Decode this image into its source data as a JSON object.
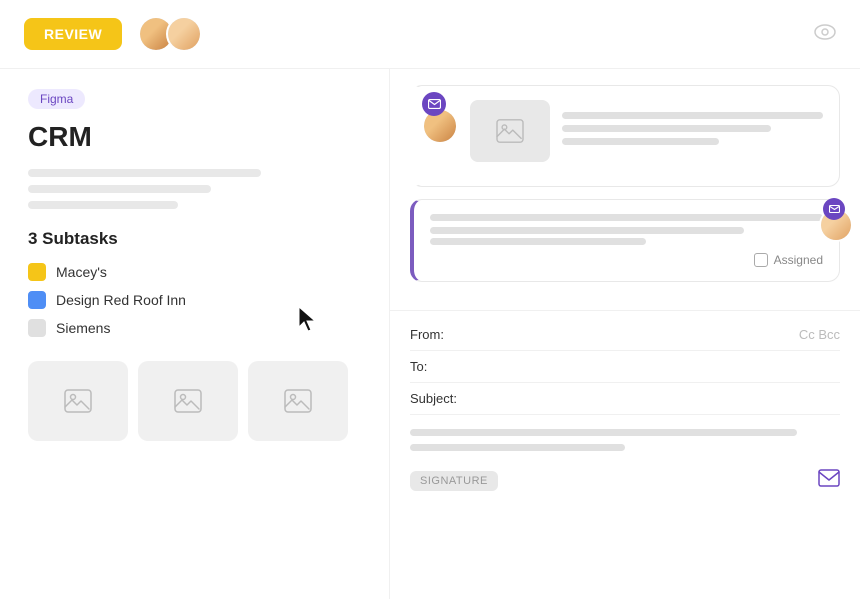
{
  "header": {
    "review_btn": "REVIEW",
    "eye_icon": "eye"
  },
  "left": {
    "badge": "Figma",
    "title": "CRM",
    "subtasks_heading": "3 Subtasks",
    "subtasks": [
      {
        "label": "Macey's",
        "color": "yellow"
      },
      {
        "label": "Design Red Roof Inn",
        "color": "blue"
      },
      {
        "label": "Siemens",
        "color": "gray"
      }
    ]
  },
  "right": {
    "card1": {
      "lines": [
        "w100",
        "w80",
        "w60"
      ]
    },
    "card2": {
      "lines": [
        "w100",
        "w80"
      ],
      "assigned_label": "Assigned"
    },
    "email": {
      "from_label": "From:",
      "to_label": "To:",
      "subject_label": "Subject:",
      "cc_bcc": "Cc Bcc",
      "signature_label": "SIGNATURE"
    }
  }
}
